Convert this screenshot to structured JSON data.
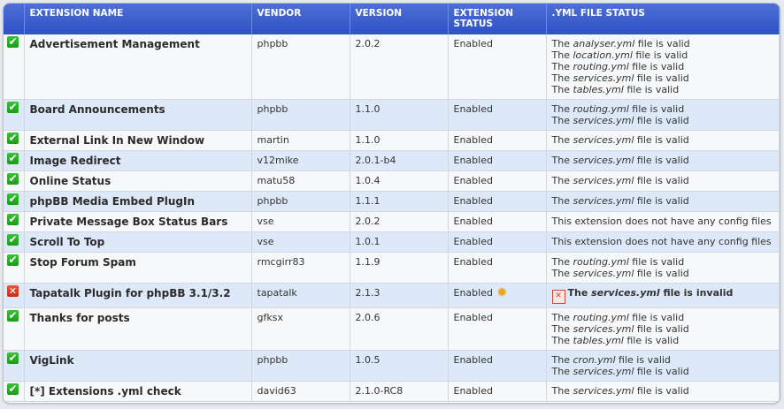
{
  "columns": [
    "",
    "EXTENSION NAME",
    "VENDOR",
    "VERSION",
    "EXTENSION STATUS",
    ".YML FILE STATUS"
  ],
  "rows": [
    {
      "icon": "check",
      "name": "Advertisement Management",
      "vendor": "phpbb",
      "version": "2.0.2",
      "status": "Enabled",
      "yml": [
        [
          "analyser.yml",
          "valid"
        ],
        [
          "location.yml",
          "valid"
        ],
        [
          "routing.yml",
          "valid"
        ],
        [
          "services.yml",
          "valid"
        ],
        [
          "tables.yml",
          "valid"
        ]
      ]
    },
    {
      "icon": "check",
      "name": "Board Announcements",
      "vendor": "phpbb",
      "version": "1.1.0",
      "status": "Enabled",
      "yml": [
        [
          "routing.yml",
          "valid"
        ],
        [
          "services.yml",
          "valid"
        ]
      ]
    },
    {
      "icon": "check",
      "name": "External Link In New Window",
      "vendor": "martin",
      "version": "1.1.0",
      "status": "Enabled",
      "yml": [
        [
          "services.yml",
          "valid"
        ]
      ]
    },
    {
      "icon": "check",
      "name": "Image Redirect",
      "vendor": "v12mike",
      "version": "2.0.1-b4",
      "status": "Enabled",
      "yml": [
        [
          "services.yml",
          "valid"
        ]
      ]
    },
    {
      "icon": "check",
      "name": "Online Status",
      "vendor": "matu58",
      "version": "1.0.4",
      "status": "Enabled",
      "yml": [
        [
          "services.yml",
          "valid"
        ]
      ]
    },
    {
      "icon": "check",
      "name": "phpBB Media Embed PlugIn",
      "vendor": "phpbb",
      "version": "1.1.1",
      "status": "Enabled",
      "yml": [
        [
          "services.yml",
          "valid"
        ]
      ]
    },
    {
      "icon": "check",
      "name": "Private Message Box Status Bars",
      "vendor": "vse",
      "version": "2.0.2",
      "status": "Enabled",
      "note": "This extension does not have any config files"
    },
    {
      "icon": "check",
      "name": "Scroll To Top",
      "vendor": "vse",
      "version": "1.0.1",
      "status": "Enabled",
      "note": "This extension does not have any config files"
    },
    {
      "icon": "check",
      "name": "Stop Forum Spam",
      "vendor": "rmcgirr83",
      "version": "1.1.9",
      "status": "Enabled",
      "yml": [
        [
          "routing.yml",
          "valid"
        ],
        [
          "services.yml",
          "valid"
        ]
      ]
    },
    {
      "icon": "error",
      "name": "Tapatalk Plugin for phpBB 3.1/3.2",
      "vendor": "tapatalk",
      "version": "2.1.3",
      "status": "Enabled",
      "gear": true,
      "yml": [
        [
          "services.yml",
          "invalid"
        ]
      ]
    },
    {
      "icon": "check",
      "name": "Thanks for posts",
      "vendor": "gfksx",
      "version": "2.0.6",
      "status": "Enabled",
      "yml": [
        [
          "routing.yml",
          "valid"
        ],
        [
          "services.yml",
          "valid"
        ],
        [
          "tables.yml",
          "valid"
        ]
      ]
    },
    {
      "icon": "check",
      "name": "VigLink",
      "vendor": "phpbb",
      "version": "1.0.5",
      "status": "Enabled",
      "yml": [
        [
          "cron.yml",
          "valid"
        ],
        [
          "services.yml",
          "valid"
        ]
      ]
    },
    {
      "icon": "check",
      "name": "[*] Extensions .yml check",
      "vendor": "david63",
      "version": "2.1.0-RC8",
      "status": "Enabled",
      "yml": [
        [
          "services.yml",
          "valid"
        ]
      ]
    }
  ],
  "yml_text": {
    "prefix": "The ",
    "middle": " file is "
  }
}
